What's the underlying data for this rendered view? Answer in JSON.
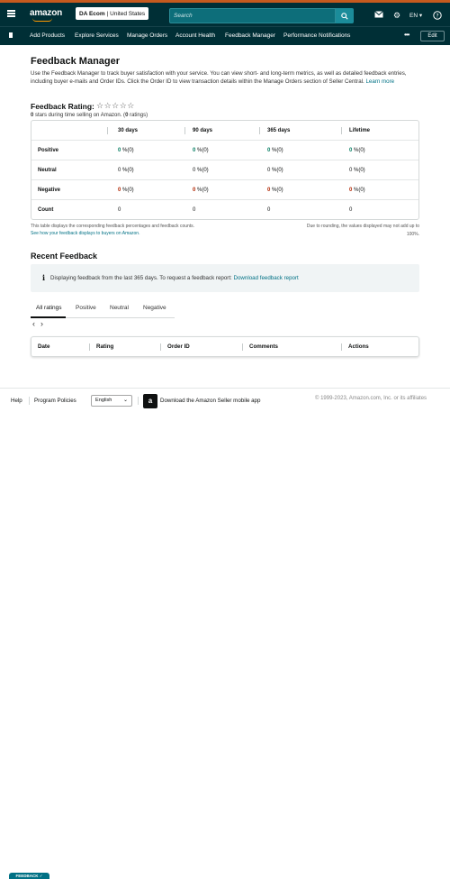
{
  "header": {
    "logo_text": "amazon",
    "account_name": "DA Ecom",
    "account_region": "| United States",
    "search_placeholder": "Search",
    "language": "EN",
    "icons": [
      "menu-icon",
      "search-icon",
      "mail-icon",
      "gear-icon",
      "help-icon"
    ]
  },
  "nav": {
    "items": [
      "Add Products",
      "Explore Services",
      "Manage Orders",
      "Account Health",
      "Feedback Manager",
      "Performance Notifications"
    ],
    "more": "•••",
    "edit_label": "Edit"
  },
  "page": {
    "title": "Feedback Manager",
    "intro": "Use the Feedback Manager to track buyer satisfaction with your service. You can view short- and long-term metrics, as well as detailed feedback entries, including buyer e-mails and Order IDs. Click the Order ID to view transaction details within the Manage Orders section of Seller Central.",
    "learn_more": "Learn more",
    "rating_label": "Feedback Rating:",
    "stars": "☆☆☆☆☆",
    "rating_sub_prefix": "0",
    "rating_sub_mid": " stars during time selling on Amazon. (",
    "rating_sub_count": "0",
    "rating_sub_suffix": " ratings)"
  },
  "feedback_table": {
    "columns": [
      "30 days",
      "90 days",
      "365 days",
      "Lifetime"
    ],
    "rows": [
      {
        "label": "Positive",
        "values": [
          "0",
          "0",
          "0",
          "0"
        ],
        "suffix": " %(0)",
        "tone": "green"
      },
      {
        "label": "Neutral",
        "values": [
          "0 %(0)",
          "0 %(0)",
          "0 %(0)",
          "0 %(0)"
        ]
      },
      {
        "label": "Negative",
        "values": [
          "0",
          "0",
          "0",
          "0"
        ],
        "suffix": " %(0)",
        "tone": "red"
      },
      {
        "label": "Count",
        "values": [
          "0",
          "0",
          "0",
          "0"
        ]
      }
    ],
    "note_left": "This table displays the corresponding feedback percentages and feedback counts.",
    "note_link": "See how your feedback displays to buyers on Amazon.",
    "note_right": "Due to rounding, the values displayed may not add up to 100%."
  },
  "recent": {
    "title": "Recent Feedback",
    "info_text": "Displaying feedback from the last 365 days. To request a feedback report: ",
    "info_link": "Download feedback report",
    "tabs": [
      "All ratings",
      "Positive",
      "Neutral",
      "Negative"
    ],
    "active_tab": "All ratings",
    "pager_prev": "‹",
    "pager_next": "›",
    "columns": [
      "Date",
      "Rating",
      "Order ID",
      "Comments",
      "Actions"
    ]
  },
  "footer": {
    "help": "Help",
    "policies": "Program Policies",
    "language_selected": "English",
    "app_text": "Download the Amazon Seller mobile app",
    "copyright": "© 1999-2023, Amazon.com, Inc. or its affiliates"
  },
  "feedback_tab": "FEEDBACK ✓"
}
